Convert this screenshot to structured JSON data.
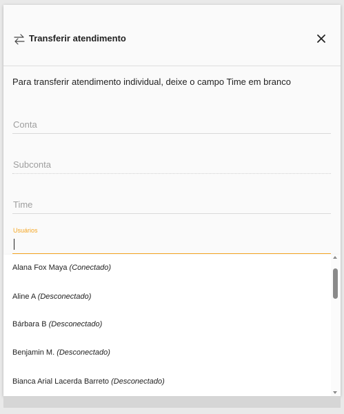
{
  "dialog": {
    "title": "Transferir atendimento",
    "info_text": "Para transferir atendimento individual, deixe o campo Time em branco"
  },
  "fields": {
    "conta_placeholder": "Conta",
    "subconta_placeholder": "Subconta",
    "time_placeholder": "Time",
    "usuarios_label": "Usuários",
    "usuarios_value": ""
  },
  "users": [
    {
      "name": "Alana Fox Maya",
      "status": "(Conectado)"
    },
    {
      "name": "Aline A",
      "status": "(Desconectado)"
    },
    {
      "name": "Bárbara B",
      "status": "(Desconectado)"
    },
    {
      "name": "Benjamin M.",
      "status": "(Desconectado)"
    },
    {
      "name": "Bianca Arial Lacerda Barreto",
      "status": "(Desconectado)"
    }
  ],
  "colors": {
    "accent": "#f5a623"
  },
  "icons": {
    "header": "swap-arrows-icon",
    "close": "close-icon"
  }
}
